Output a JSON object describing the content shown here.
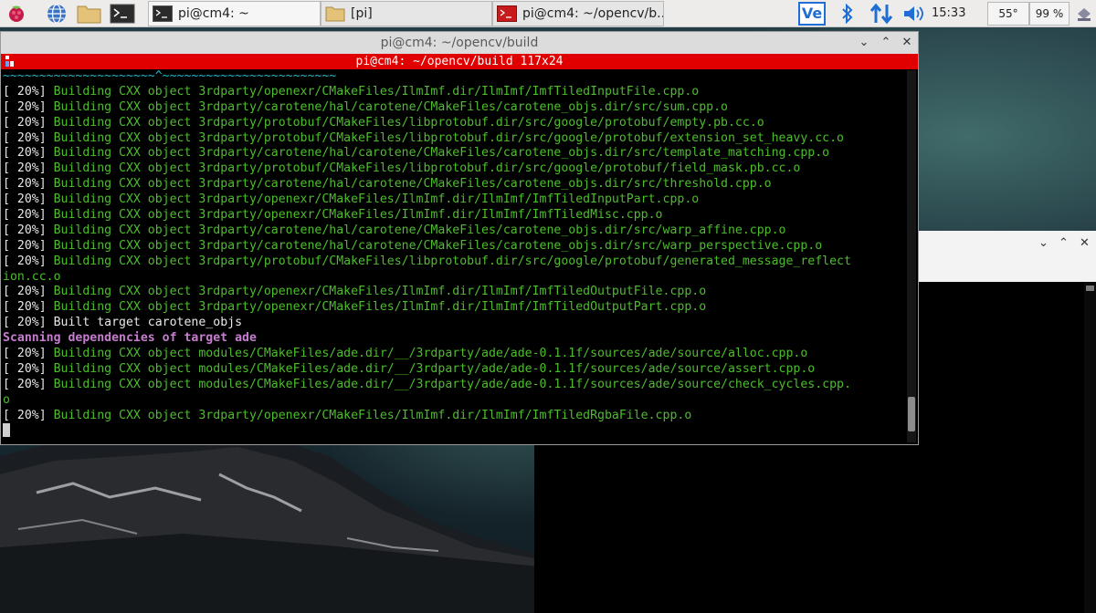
{
  "taskbar": {
    "tasks": [
      {
        "label": "pi@cm4: ~",
        "active": true
      },
      {
        "label": "[pi]",
        "active": false
      },
      {
        "label": "pi@cm4: ~/opencv/b...",
        "active": false
      }
    ],
    "clock": "15:33",
    "temperature": "55°",
    "cpu_usage": "99 %",
    "vnc_label": "Ve"
  },
  "window": {
    "title": "pi@cm4: ~/opencv/build",
    "terminal_header": "pi@cm4: ~/opencv/build 117x24",
    "lines": [
      {
        "kind": "tilde",
        "text": "~~~~~~~~~~~~~~~~~~~~~^~~~~~~~~~~~~~~~~~~~~~~~~"
      },
      {
        "kind": "build",
        "pct": "[ 20%] ",
        "text": "Building CXX object 3rdparty/openexr/CMakeFiles/IlmImf.dir/IlmImf/ImfTiledInputFile.cpp.o"
      },
      {
        "kind": "build",
        "pct": "[ 20%] ",
        "text": "Building CXX object 3rdparty/carotene/hal/carotene/CMakeFiles/carotene_objs.dir/src/sum.cpp.o"
      },
      {
        "kind": "build",
        "pct": "[ 20%] ",
        "text": "Building CXX object 3rdparty/protobuf/CMakeFiles/libprotobuf.dir/src/google/protobuf/empty.pb.cc.o"
      },
      {
        "kind": "build",
        "pct": "[ 20%] ",
        "text": "Building CXX object 3rdparty/protobuf/CMakeFiles/libprotobuf.dir/src/google/protobuf/extension_set_heavy.cc.o"
      },
      {
        "kind": "build",
        "pct": "[ 20%] ",
        "text": "Building CXX object 3rdparty/carotene/hal/carotene/CMakeFiles/carotene_objs.dir/src/template_matching.cpp.o"
      },
      {
        "kind": "build",
        "pct": "[ 20%] ",
        "text": "Building CXX object 3rdparty/protobuf/CMakeFiles/libprotobuf.dir/src/google/protobuf/field_mask.pb.cc.o"
      },
      {
        "kind": "build",
        "pct": "[ 20%] ",
        "text": "Building CXX object 3rdparty/carotene/hal/carotene/CMakeFiles/carotene_objs.dir/src/threshold.cpp.o"
      },
      {
        "kind": "build",
        "pct": "[ 20%] ",
        "text": "Building CXX object 3rdparty/openexr/CMakeFiles/IlmImf.dir/IlmImf/ImfTiledInputPart.cpp.o"
      },
      {
        "kind": "build",
        "pct": "[ 20%] ",
        "text": "Building CXX object 3rdparty/openexr/CMakeFiles/IlmImf.dir/IlmImf/ImfTiledMisc.cpp.o"
      },
      {
        "kind": "build",
        "pct": "[ 20%] ",
        "text": "Building CXX object 3rdparty/carotene/hal/carotene/CMakeFiles/carotene_objs.dir/src/warp_affine.cpp.o"
      },
      {
        "kind": "build",
        "pct": "[ 20%] ",
        "text": "Building CXX object 3rdparty/carotene/hal/carotene/CMakeFiles/carotene_objs.dir/src/warp_perspective.cpp.o"
      },
      {
        "kind": "build",
        "pct": "[ 20%] ",
        "text": "Building CXX object 3rdparty/protobuf/CMakeFiles/libprotobuf.dir/src/google/protobuf/generated_message_reflect"
      },
      {
        "kind": "cont",
        "text": "ion.cc.o"
      },
      {
        "kind": "build",
        "pct": "[ 20%] ",
        "text": "Building CXX object 3rdparty/openexr/CMakeFiles/IlmImf.dir/IlmImf/ImfTiledOutputFile.cpp.o"
      },
      {
        "kind": "build",
        "pct": "[ 20%] ",
        "text": "Building CXX object 3rdparty/openexr/CMakeFiles/IlmImf.dir/IlmImf/ImfTiledOutputPart.cpp.o"
      },
      {
        "kind": "built",
        "pct": "[ 20%] ",
        "text": "Built target carotene_objs"
      },
      {
        "kind": "scan",
        "text": "Scanning dependencies of target ade"
      },
      {
        "kind": "build",
        "pct": "[ 20%] ",
        "text": "Building CXX object modules/CMakeFiles/ade.dir/__/3rdparty/ade/ade-0.1.1f/sources/ade/source/alloc.cpp.o"
      },
      {
        "kind": "build",
        "pct": "[ 20%] ",
        "text": "Building CXX object modules/CMakeFiles/ade.dir/__/3rdparty/ade/ade-0.1.1f/sources/ade/source/assert.cpp.o"
      },
      {
        "kind": "build",
        "pct": "[ 20%] ",
        "text": "Building CXX object modules/CMakeFiles/ade.dir/__/3rdparty/ade/ade-0.1.1f/sources/ade/source/check_cycles.cpp."
      },
      {
        "kind": "cont",
        "text": "o"
      },
      {
        "kind": "build",
        "pct": "[ 20%] ",
        "text": "Building CXX object 3rdparty/openexr/CMakeFiles/IlmImf.dir/IlmImf/ImfTiledRgbaFile.cpp.o"
      },
      {
        "kind": "cursor",
        "text": ""
      }
    ]
  },
  "colors": {
    "terminal_bg": "#000000",
    "build_text": "#4dbd2c",
    "scan_text": "#c77dd0",
    "header_bar": "#e00000"
  }
}
